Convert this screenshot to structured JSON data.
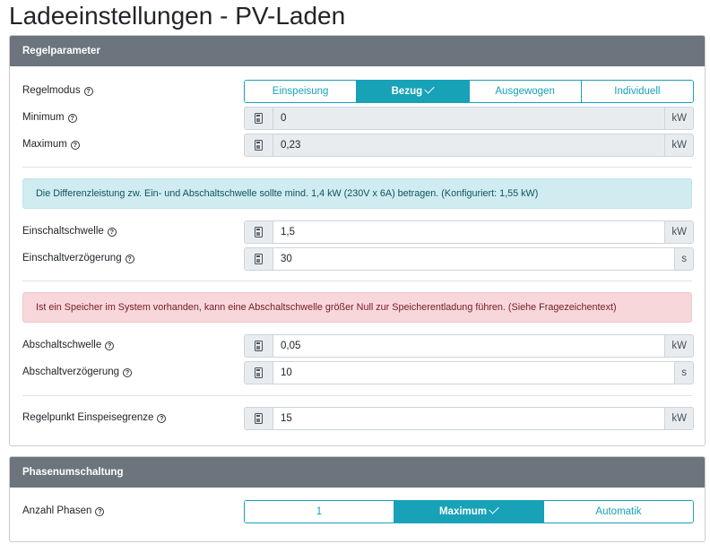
{
  "page": {
    "title": "Ladeeinstellungen - PV-Laden"
  },
  "regelparameter": {
    "header": "Regelparameter",
    "regelmodus": {
      "label": "Regelmodus",
      "options": [
        "Einspeisung",
        "Bezug",
        "Ausgewogen",
        "Individuell"
      ],
      "selected": "Bezug"
    },
    "minimum": {
      "label": "Minimum",
      "value": "0",
      "unit": "kW"
    },
    "maximum": {
      "label": "Maximum",
      "value": "0,23",
      "unit": "kW"
    },
    "info_alert": "Die Differenzleistung zw. Ein- und Abschaltschwelle sollte mind. 1,4 kW (230V x 6A) betragen. (Konfiguriert: 1,55 kW)",
    "einschaltschwelle": {
      "label": "Einschaltschwelle",
      "value": "1,5",
      "unit": "kW"
    },
    "einschaltverzoegerung": {
      "label": "Einschaltverzögerung",
      "value": "30",
      "unit": "s"
    },
    "danger_alert": "Ist ein Speicher im System vorhanden, kann eine Abschaltschwelle größer Null zur Speicherentladung führen. (Siehe Fragezeichentext)",
    "abschaltschwelle": {
      "label": "Abschaltschwelle",
      "value": "0,05",
      "unit": "kW"
    },
    "abschaltverzoegerung": {
      "label": "Abschaltverzögerung",
      "value": "10",
      "unit": "s"
    },
    "regelpunkt": {
      "label": "Regelpunkt Einspeisegrenze",
      "value": "15",
      "unit": "kW"
    }
  },
  "phasenumschaltung": {
    "header": "Phasenumschaltung",
    "anzahl_phasen": {
      "label": "Anzahl Phasen",
      "options": [
        "1",
        "Maximum",
        "Automatik"
      ],
      "selected": "Maximum"
    }
  },
  "icons": {
    "help": "help-circle-icon",
    "calculator": "calculator-icon",
    "check": "check-icon"
  },
  "colors": {
    "accent": "#17a2b8",
    "header_bg": "#6c757d",
    "info_bg": "#d1ecf1",
    "danger_bg": "#f8d7da"
  },
  "glyphs": {
    "help": "?"
  }
}
